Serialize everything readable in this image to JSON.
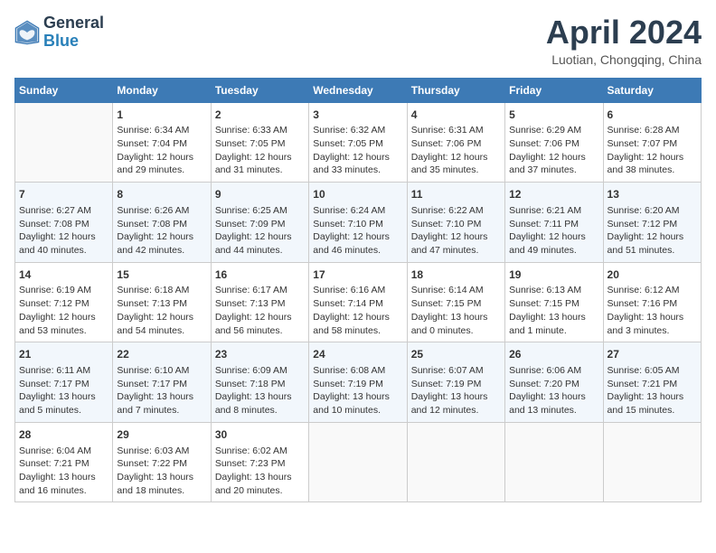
{
  "header": {
    "logo_line1": "General",
    "logo_line2": "Blue",
    "month_title": "April 2024",
    "location": "Luotian, Chongqing, China"
  },
  "days_of_week": [
    "Sunday",
    "Monday",
    "Tuesday",
    "Wednesday",
    "Thursday",
    "Friday",
    "Saturday"
  ],
  "weeks": [
    [
      {
        "day": "",
        "sunrise": "",
        "sunset": "",
        "daylight": ""
      },
      {
        "day": "1",
        "sunrise": "Sunrise: 6:34 AM",
        "sunset": "Sunset: 7:04 PM",
        "daylight": "Daylight: 12 hours and 29 minutes."
      },
      {
        "day": "2",
        "sunrise": "Sunrise: 6:33 AM",
        "sunset": "Sunset: 7:05 PM",
        "daylight": "Daylight: 12 hours and 31 minutes."
      },
      {
        "day": "3",
        "sunrise": "Sunrise: 6:32 AM",
        "sunset": "Sunset: 7:05 PM",
        "daylight": "Daylight: 12 hours and 33 minutes."
      },
      {
        "day": "4",
        "sunrise": "Sunrise: 6:31 AM",
        "sunset": "Sunset: 7:06 PM",
        "daylight": "Daylight: 12 hours and 35 minutes."
      },
      {
        "day": "5",
        "sunrise": "Sunrise: 6:29 AM",
        "sunset": "Sunset: 7:06 PM",
        "daylight": "Daylight: 12 hours and 37 minutes."
      },
      {
        "day": "6",
        "sunrise": "Sunrise: 6:28 AM",
        "sunset": "Sunset: 7:07 PM",
        "daylight": "Daylight: 12 hours and 38 minutes."
      }
    ],
    [
      {
        "day": "7",
        "sunrise": "Sunrise: 6:27 AM",
        "sunset": "Sunset: 7:08 PM",
        "daylight": "Daylight: 12 hours and 40 minutes."
      },
      {
        "day": "8",
        "sunrise": "Sunrise: 6:26 AM",
        "sunset": "Sunset: 7:08 PM",
        "daylight": "Daylight: 12 hours and 42 minutes."
      },
      {
        "day": "9",
        "sunrise": "Sunrise: 6:25 AM",
        "sunset": "Sunset: 7:09 PM",
        "daylight": "Daylight: 12 hours and 44 minutes."
      },
      {
        "day": "10",
        "sunrise": "Sunrise: 6:24 AM",
        "sunset": "Sunset: 7:10 PM",
        "daylight": "Daylight: 12 hours and 46 minutes."
      },
      {
        "day": "11",
        "sunrise": "Sunrise: 6:22 AM",
        "sunset": "Sunset: 7:10 PM",
        "daylight": "Daylight: 12 hours and 47 minutes."
      },
      {
        "day": "12",
        "sunrise": "Sunrise: 6:21 AM",
        "sunset": "Sunset: 7:11 PM",
        "daylight": "Daylight: 12 hours and 49 minutes."
      },
      {
        "day": "13",
        "sunrise": "Sunrise: 6:20 AM",
        "sunset": "Sunset: 7:12 PM",
        "daylight": "Daylight: 12 hours and 51 minutes."
      }
    ],
    [
      {
        "day": "14",
        "sunrise": "Sunrise: 6:19 AM",
        "sunset": "Sunset: 7:12 PM",
        "daylight": "Daylight: 12 hours and 53 minutes."
      },
      {
        "day": "15",
        "sunrise": "Sunrise: 6:18 AM",
        "sunset": "Sunset: 7:13 PM",
        "daylight": "Daylight: 12 hours and 54 minutes."
      },
      {
        "day": "16",
        "sunrise": "Sunrise: 6:17 AM",
        "sunset": "Sunset: 7:13 PM",
        "daylight": "Daylight: 12 hours and 56 minutes."
      },
      {
        "day": "17",
        "sunrise": "Sunrise: 6:16 AM",
        "sunset": "Sunset: 7:14 PM",
        "daylight": "Daylight: 12 hours and 58 minutes."
      },
      {
        "day": "18",
        "sunrise": "Sunrise: 6:14 AM",
        "sunset": "Sunset: 7:15 PM",
        "daylight": "Daylight: 13 hours and 0 minutes."
      },
      {
        "day": "19",
        "sunrise": "Sunrise: 6:13 AM",
        "sunset": "Sunset: 7:15 PM",
        "daylight": "Daylight: 13 hours and 1 minute."
      },
      {
        "day": "20",
        "sunrise": "Sunrise: 6:12 AM",
        "sunset": "Sunset: 7:16 PM",
        "daylight": "Daylight: 13 hours and 3 minutes."
      }
    ],
    [
      {
        "day": "21",
        "sunrise": "Sunrise: 6:11 AM",
        "sunset": "Sunset: 7:17 PM",
        "daylight": "Daylight: 13 hours and 5 minutes."
      },
      {
        "day": "22",
        "sunrise": "Sunrise: 6:10 AM",
        "sunset": "Sunset: 7:17 PM",
        "daylight": "Daylight: 13 hours and 7 minutes."
      },
      {
        "day": "23",
        "sunrise": "Sunrise: 6:09 AM",
        "sunset": "Sunset: 7:18 PM",
        "daylight": "Daylight: 13 hours and 8 minutes."
      },
      {
        "day": "24",
        "sunrise": "Sunrise: 6:08 AM",
        "sunset": "Sunset: 7:19 PM",
        "daylight": "Daylight: 13 hours and 10 minutes."
      },
      {
        "day": "25",
        "sunrise": "Sunrise: 6:07 AM",
        "sunset": "Sunset: 7:19 PM",
        "daylight": "Daylight: 13 hours and 12 minutes."
      },
      {
        "day": "26",
        "sunrise": "Sunrise: 6:06 AM",
        "sunset": "Sunset: 7:20 PM",
        "daylight": "Daylight: 13 hours and 13 minutes."
      },
      {
        "day": "27",
        "sunrise": "Sunrise: 6:05 AM",
        "sunset": "Sunset: 7:21 PM",
        "daylight": "Daylight: 13 hours and 15 minutes."
      }
    ],
    [
      {
        "day": "28",
        "sunrise": "Sunrise: 6:04 AM",
        "sunset": "Sunset: 7:21 PM",
        "daylight": "Daylight: 13 hours and 16 minutes."
      },
      {
        "day": "29",
        "sunrise": "Sunrise: 6:03 AM",
        "sunset": "Sunset: 7:22 PM",
        "daylight": "Daylight: 13 hours and 18 minutes."
      },
      {
        "day": "30",
        "sunrise": "Sunrise: 6:02 AM",
        "sunset": "Sunset: 7:23 PM",
        "daylight": "Daylight: 13 hours and 20 minutes."
      },
      {
        "day": "",
        "sunrise": "",
        "sunset": "",
        "daylight": ""
      },
      {
        "day": "",
        "sunrise": "",
        "sunset": "",
        "daylight": ""
      },
      {
        "day": "",
        "sunrise": "",
        "sunset": "",
        "daylight": ""
      },
      {
        "day": "",
        "sunrise": "",
        "sunset": "",
        "daylight": ""
      }
    ]
  ]
}
